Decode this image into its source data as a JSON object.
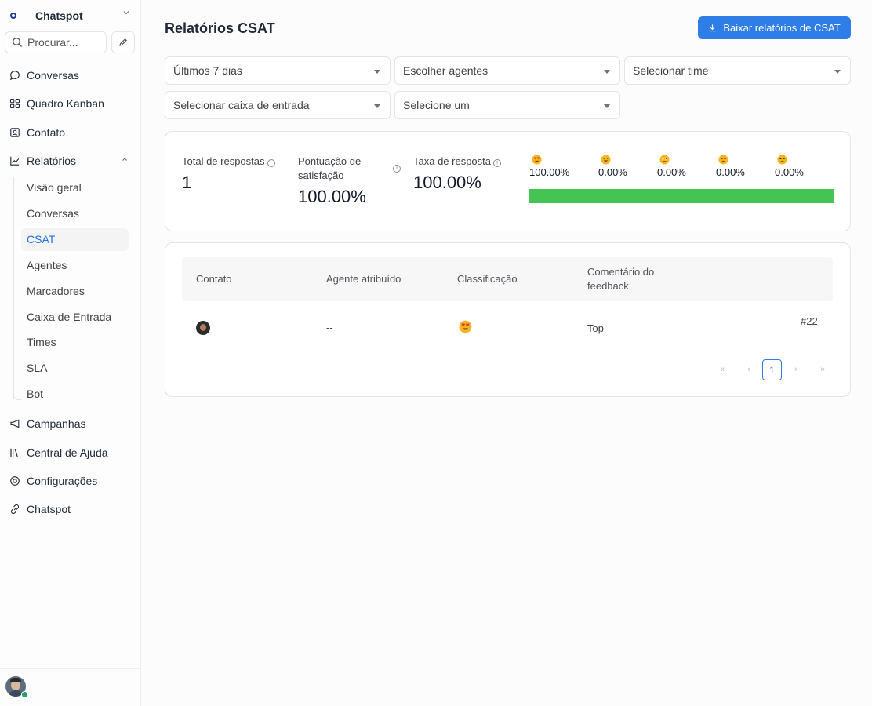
{
  "sidebar": {
    "workspace": "Chatspot",
    "search_placeholder": "Procurar...",
    "nav": [
      {
        "label": "Conversas",
        "icon": "chat-bubble-icon"
      },
      {
        "label": "Quadro Kanban",
        "icon": "kanban-grid-icon"
      },
      {
        "label": "Contato",
        "icon": "contact-card-icon"
      },
      {
        "label": "Relatórios",
        "icon": "chart-line-icon"
      },
      {
        "label": "Campanhas",
        "icon": "megaphone-icon"
      },
      {
        "label": "Central de Ajuda",
        "icon": "library-icon"
      },
      {
        "label": "Configurações",
        "icon": "settings-icon"
      },
      {
        "label": "Chatspot",
        "icon": "link-icon"
      }
    ],
    "reports_sub": [
      "Visão geral",
      "Conversas",
      "CSAT",
      "Agentes",
      "Marcadores",
      "Caixa de Entrada",
      "Times",
      "SLA",
      "Bot"
    ],
    "active_sub": "CSAT"
  },
  "header": {
    "title": "Relatórios CSAT",
    "download_label": "Baixar relatórios de CSAT"
  },
  "filters": {
    "period": "Últimos 7 dias",
    "agents": "Escolher agentes",
    "team": "Selecionar time",
    "inbox": "Selecionar caixa de entrada",
    "rating": "Selecione um"
  },
  "metrics": {
    "total_label": "Total de respostas",
    "total_value": "1",
    "satisfaction_label": "Pontuação de satisfação",
    "satisfaction_value": "100.00%",
    "response_rate_label": "Taxa de resposta",
    "response_rate_value": "100.00%",
    "ratings": [
      {
        "emoji": "😍",
        "pct": "100.00%"
      },
      {
        "emoji": "😀",
        "pct": "0.00%"
      },
      {
        "emoji": "😐",
        "pct": "0.00%"
      },
      {
        "emoji": "😑",
        "pct": "0.00%"
      },
      {
        "emoji": "😞",
        "pct": "0.00%"
      }
    ],
    "distribution_fraction": 1.0
  },
  "table": {
    "headers": {
      "contact": "Contato",
      "agent": "Agente atribuído",
      "rating": "Classificação",
      "feedback": "Comentário do feedback"
    },
    "rows": [
      {
        "agent": "--",
        "rating": "😍",
        "feedback": "Top",
        "conversation": "#22"
      }
    ]
  },
  "pagination": {
    "first": "«",
    "prev": "‹",
    "current": "1",
    "next": "›",
    "last": "»"
  },
  "colors": {
    "accent": "#2f7ee8",
    "bar_fill": "#44c553",
    "active_sub": "#1f6fe5"
  }
}
